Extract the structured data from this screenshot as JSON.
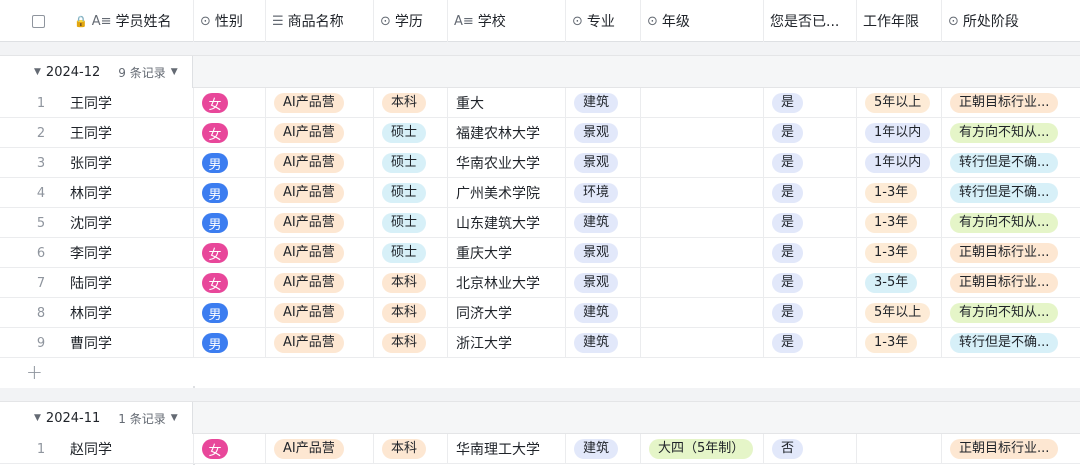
{
  "columns": [
    {
      "label": "学员姓名",
      "icon": "text-icon"
    },
    {
      "label": "性别",
      "icon": "select-icon"
    },
    {
      "label": "商品名称",
      "icon": "multi-select-icon"
    },
    {
      "label": "学历",
      "icon": "select-icon"
    },
    {
      "label": "学校",
      "icon": "text-icon"
    },
    {
      "label": "专业",
      "icon": "select-icon"
    },
    {
      "label": "年级",
      "icon": "select-icon"
    },
    {
      "label": "您是否已...",
      "icon": ""
    },
    {
      "label": "工作年限",
      "icon": ""
    },
    {
      "label": "所处阶段",
      "icon": "select-icon"
    }
  ],
  "groups": [
    {
      "title": "2024-12",
      "count": "9 条记录",
      "rows": [
        {
          "idx": "1",
          "name": "王同学",
          "sex": "女",
          "product": "AI产品营",
          "edu": "本科",
          "school": "重大",
          "major": "建筑",
          "grade": "",
          "yes": "是",
          "years": "5年以上",
          "stage": "正朝目标行业..."
        },
        {
          "idx": "2",
          "name": "王同学",
          "sex": "女",
          "product": "AI产品营",
          "edu": "硕士",
          "school": "福建农林大学",
          "major": "景观",
          "grade": "",
          "yes": "是",
          "years": "1年以内",
          "stage": "有方向不知从..."
        },
        {
          "idx": "3",
          "name": "张同学",
          "sex": "男",
          "product": "AI产品营",
          "edu": "硕士",
          "school": "华南农业大学",
          "major": "景观",
          "grade": "",
          "yes": "是",
          "years": "1年以内",
          "stage": "转行但是不确..."
        },
        {
          "idx": "4",
          "name": "林同学",
          "sex": "男",
          "product": "AI产品营",
          "edu": "硕士",
          "school": "广州美术学院",
          "major": "环境",
          "grade": "",
          "yes": "是",
          "years": "1-3年",
          "stage": "转行但是不确..."
        },
        {
          "idx": "5",
          "name": "沈同学",
          "sex": "男",
          "product": "AI产品营",
          "edu": "硕士",
          "school": "山东建筑大学",
          "major": "建筑",
          "grade": "",
          "yes": "是",
          "years": "1-3年",
          "stage": "有方向不知从..."
        },
        {
          "idx": "6",
          "name": "李同学",
          "sex": "女",
          "product": "AI产品营",
          "edu": "硕士",
          "school": "重庆大学",
          "major": "景观",
          "grade": "",
          "yes": "是",
          "years": "1-3年",
          "stage": "正朝目标行业..."
        },
        {
          "idx": "7",
          "name": "陆同学",
          "sex": "女",
          "product": "AI产品营",
          "edu": "本科",
          "school": "北京林业大学",
          "major": "景观",
          "grade": "",
          "yes": "是",
          "years": "3-5年",
          "stage": "正朝目标行业..."
        },
        {
          "idx": "8",
          "name": "林同学",
          "sex": "男",
          "product": "AI产品营",
          "edu": "本科",
          "school": "同济大学",
          "major": "建筑",
          "grade": "",
          "yes": "是",
          "years": "5年以上",
          "stage": "有方向不知从..."
        },
        {
          "idx": "9",
          "name": "曹同学",
          "sex": "男",
          "product": "AI产品营",
          "edu": "本科",
          "school": "浙江大学",
          "major": "建筑",
          "grade": "",
          "yes": "是",
          "years": "1-3年",
          "stage": "转行但是不确..."
        }
      ]
    },
    {
      "title": "2024-11",
      "count": "1 条记录",
      "rows": [
        {
          "idx": "1",
          "name": "赵同学",
          "sex": "女",
          "product": "AI产品营",
          "edu": "本科",
          "school": "华南理工大学",
          "major": "建筑",
          "grade": "大四（5年制）",
          "yes": "否",
          "years": "",
          "stage": "正朝目标行业..."
        }
      ]
    }
  ],
  "add_label": "+",
  "colors": {
    "female": "#e8479a",
    "male": "#3c7df0",
    "product_bg": "#fde7d2",
    "edu_benke_bg": "#fde7d2",
    "edu_shuoshi_bg": "#d7f0f8",
    "major_bg": "#e2e8fa",
    "yes_bg": "#e2e8fa",
    "years_warm_bg": "#fdebd6",
    "years_cool_bg": "#e2e8fa",
    "years_blue_bg": "#d7f0f8",
    "stage_orange_bg": "#fde7d2",
    "stage_green_bg": "#e5f5c8",
    "stage_blue_bg": "#d7f0f8",
    "grade_bg": "#e5f5c8"
  }
}
